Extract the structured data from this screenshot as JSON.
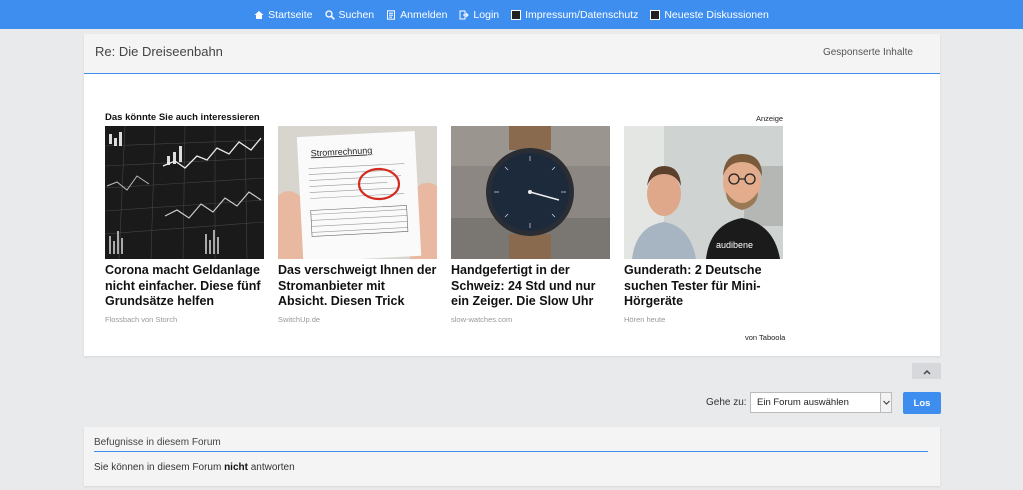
{
  "nav": {
    "items": [
      {
        "label": "Startseite",
        "icon": "home-icon"
      },
      {
        "label": "Suchen",
        "icon": "search-icon"
      },
      {
        "label": "Anmelden",
        "icon": "register-icon"
      },
      {
        "label": "Login",
        "icon": "login-icon"
      },
      {
        "label": "Impressum/Datenschutz",
        "icon": "imprint-icon"
      },
      {
        "label": "Neueste Diskussionen",
        "icon": "discussions-icon"
      }
    ],
    "bg_color": "#3e8ef0"
  },
  "post": {
    "title": "Re: Die Dreiseenbahn",
    "sponsored_label": "Gesponserte Inhalte"
  },
  "ads": {
    "heading": "Das könnte Sie auch interessieren",
    "label": "Anzeige",
    "provider": "von Taboola",
    "items": [
      {
        "title": "Corona macht Geldanlage nicht einfacher. Diese fünf Grundsätze helfen Anlege…",
        "source": "Flossbach von Storch",
        "image": "stock-chart-screen"
      },
      {
        "title": "Das verschweigt Ihnen der Stromanbieter mit Absicht. Diesen Trick sollten Sie…",
        "source": "SwitchUp.de",
        "image": "electricity-bill",
        "image_text": "Stromrechnung"
      },
      {
        "title": "Handgefertigt in der Schweiz: 24 Std und nur ein Zeiger. Die Slow Uhr hilft d…",
        "source": "slow-watches.com",
        "image": "wristwatch"
      },
      {
        "title": "Gunderath: 2 Deutsche suchen Tester für Mini-Hörgeräte",
        "source": "Hören heute",
        "image": "two-men-portrait",
        "image_text": "audibene"
      }
    ]
  },
  "jump": {
    "label": "Gehe zu:",
    "selected": "Ein Forum auswählen",
    "go_label": "Los"
  },
  "permissions": {
    "title": "Befugnisse in diesem Forum",
    "text_before": "Sie können in diesem Forum ",
    "text_bold": "nicht",
    "text_after": " antworten"
  }
}
